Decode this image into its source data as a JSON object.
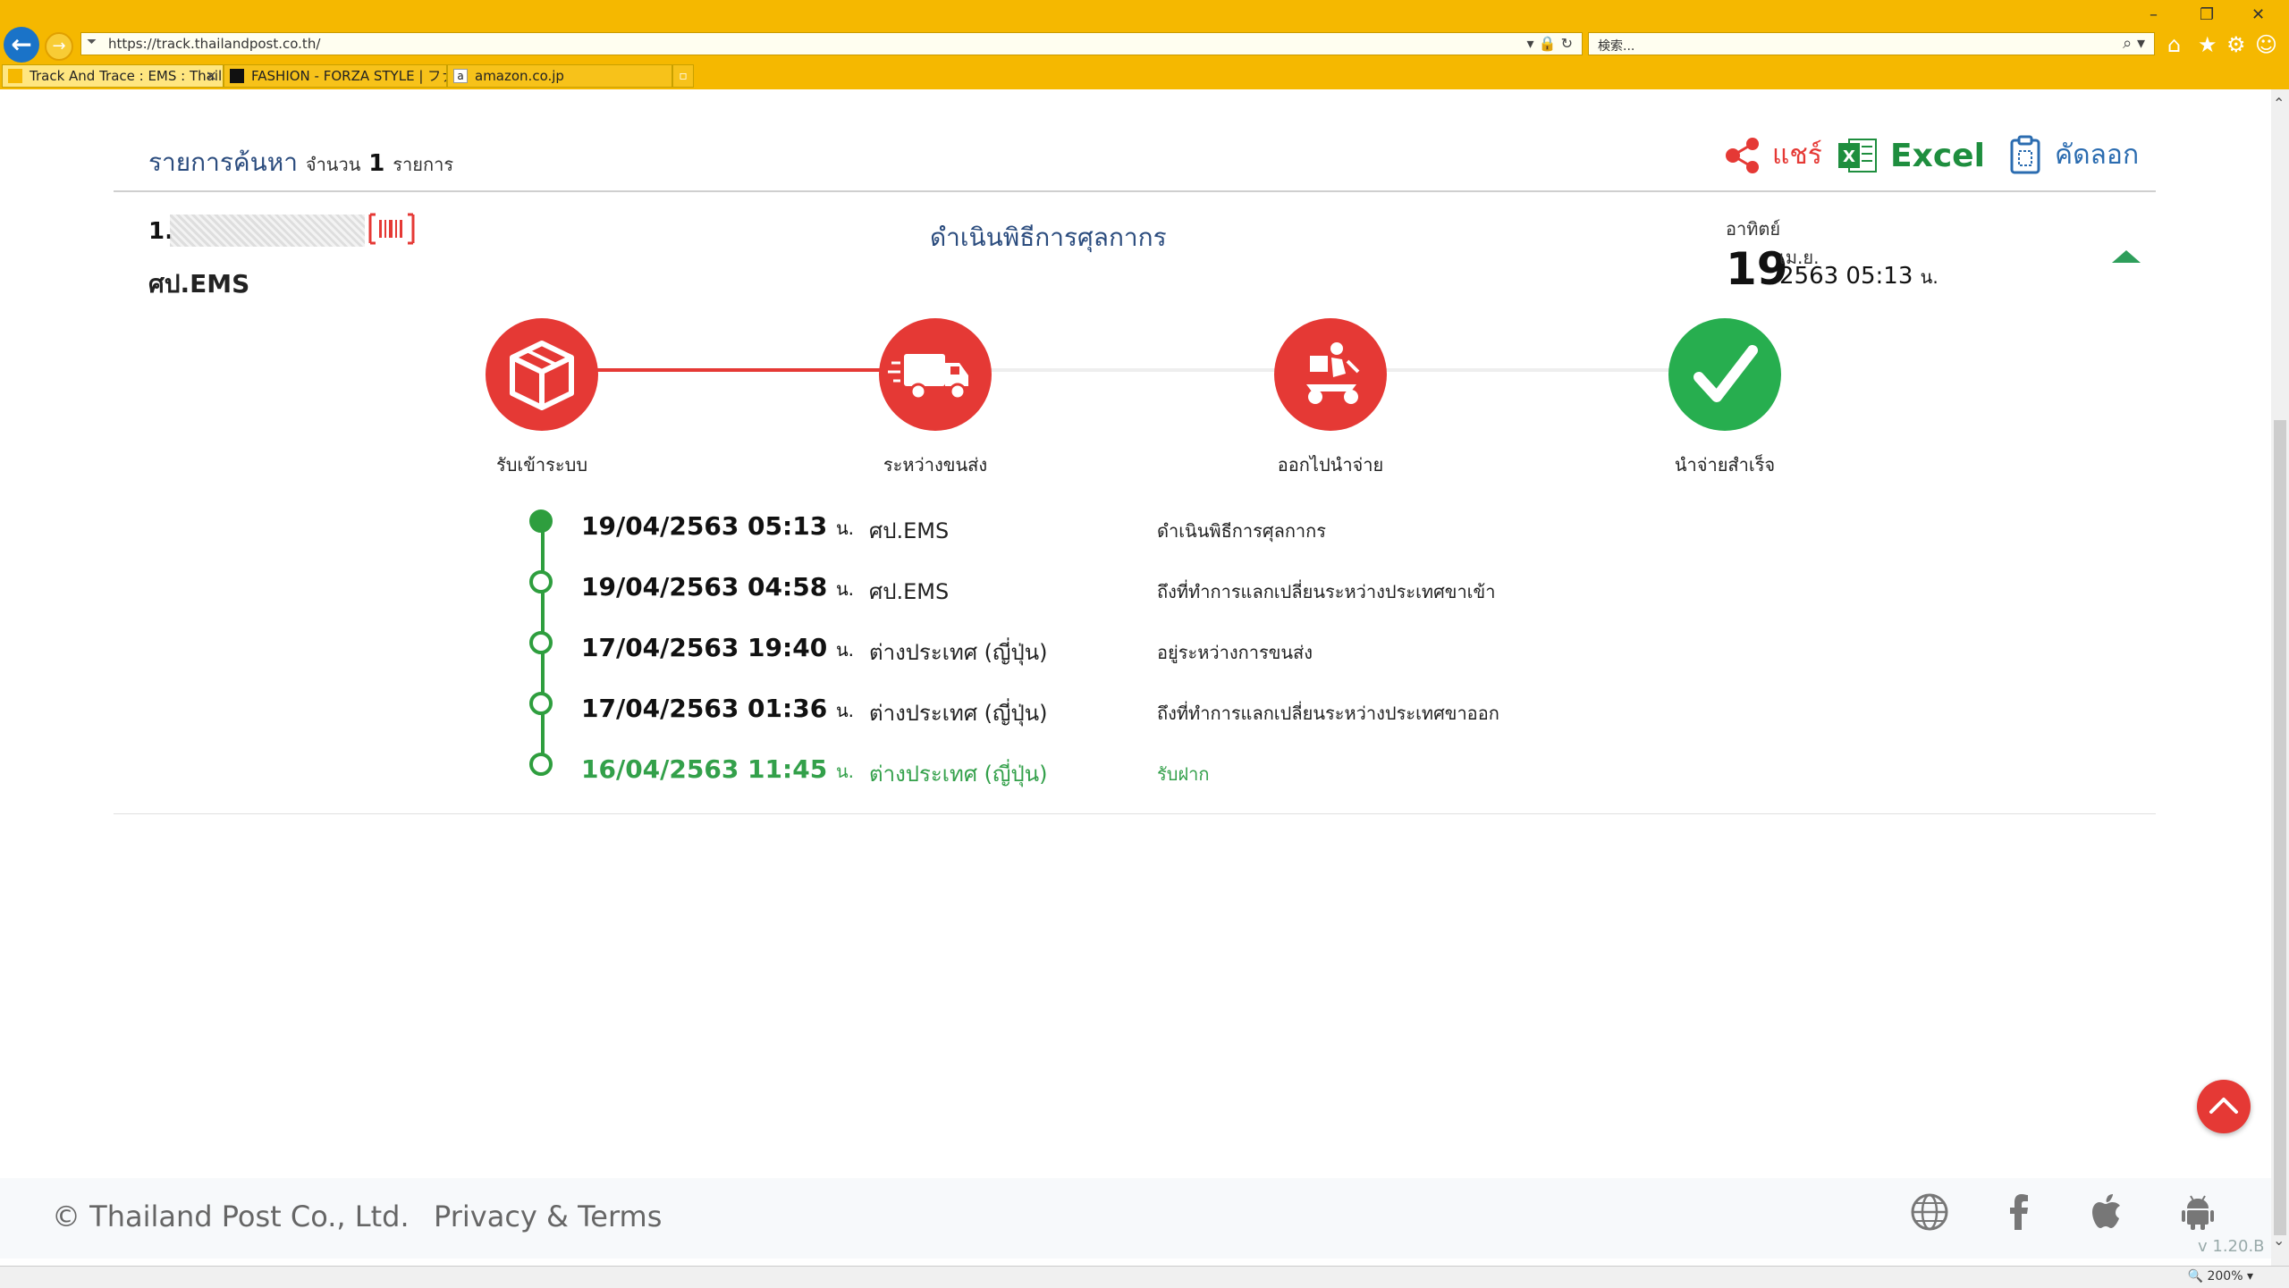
{
  "browser": {
    "url": "https://track.thailandpost.co.th/",
    "search_placeholder": "検索...",
    "tabs": [
      {
        "label": "Track And Trace : EMS : Thail..."
      },
      {
        "label": "FASHION - FORZA STYLE | ファ..."
      },
      {
        "label": "amazon.co.jp"
      }
    ],
    "zoom": "200%"
  },
  "results": {
    "title": "รายการค้นหา",
    "count_prefix": "จำนวน",
    "count": "1",
    "count_suffix": "รายการ",
    "actions": {
      "share": "แชร์",
      "excel": "Excel",
      "copy": "คัดลอก"
    }
  },
  "item": {
    "number": "1.",
    "carrier": "ศป.EMS",
    "status": "ดำเนินพิธีการศุลกากร",
    "day_name": "อาทิตย์",
    "day": "19",
    "month": "เม.ย.",
    "year_time": "2563 05:13",
    "time_unit": "น."
  },
  "progress_steps": [
    {
      "label": "รับเข้าระบบ",
      "icon": "box-icon",
      "state": "done"
    },
    {
      "label": "ระหว่างขนส่ง",
      "icon": "truck-icon",
      "state": "current"
    },
    {
      "label": "ออกไปนำจ่าย",
      "icon": "delivery-scooter-icon",
      "state": "done"
    },
    {
      "label": "นำจ่ายสำเร็จ",
      "icon": "checkmark-icon",
      "state": "done"
    }
  ],
  "timeline": [
    {
      "date": "19/04/2563 05:13",
      "unit": "น.",
      "location": "ศป.EMS",
      "description": "ดำเนินพิธีการศุลกากร"
    },
    {
      "date": "19/04/2563 04:58",
      "unit": "น.",
      "location": "ศป.EMS",
      "description": "ถึงที่ทำการแลกเปลี่ยนระหว่างประเทศขาเข้า"
    },
    {
      "date": "17/04/2563 19:40",
      "unit": "น.",
      "location": "ต่างประเทศ (ญี่ปุ่น)",
      "description": "อยู่ระหว่างการขนส่ง"
    },
    {
      "date": "17/04/2563 01:36",
      "unit": "น.",
      "location": "ต่างประเทศ (ญี่ปุ่น)",
      "description": "ถึงที่ทำการแลกเปลี่ยนระหว่างประเทศขาออก"
    },
    {
      "date": "16/04/2563 11:45",
      "unit": "น.",
      "location": "ต่างประเทศ (ญี่ปุ่น)",
      "description": "รับฝาก"
    }
  ],
  "footer": {
    "copyright": "© Thailand Post Co., Ltd.",
    "privacy": "Privacy & Terms",
    "version": "v 1.20.B"
  },
  "colors": {
    "accent_red": "#e53935",
    "accent_green": "#27ae4f",
    "title_blue": "#2b4c7e",
    "browser_chrome": "#f5b800"
  }
}
